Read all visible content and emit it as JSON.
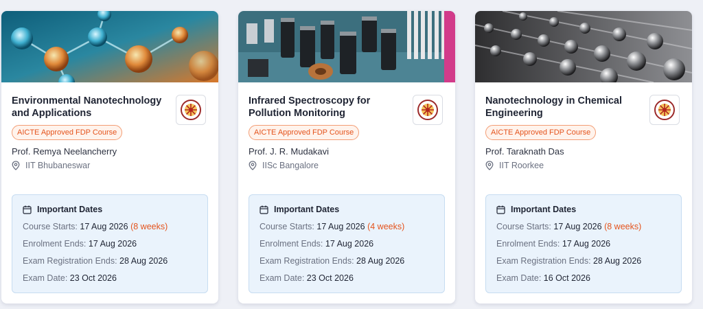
{
  "courses": [
    {
      "title": "Environmental Nanotechnology and Applications",
      "badge": "AICTE Approved FDP Course",
      "professor": "Prof. Remya Neelancherry",
      "institute": "IIT Bhubaneswar",
      "dates_heading": "Important Dates",
      "course_starts_label": "Course Starts:",
      "course_starts": "17 Aug 2026",
      "duration": "(8 weeks)",
      "enrolment_ends_label": "Enrolment Ends:",
      "enrolment_ends": "17 Aug 2026",
      "exam_registration_ends_label": "Exam Registration Ends:",
      "exam_registration_ends": "28 Aug 2026",
      "exam_date_label": "Exam Date:",
      "exam_date": "23 Oct 2026"
    },
    {
      "title": "Infrared Spectroscopy for Pollution Monitoring",
      "badge": "AICTE Approved FDP Course",
      "professor": "Prof. J. R. Mudakavi",
      "institute": "IISc Bangalore",
      "dates_heading": "Important Dates",
      "course_starts_label": "Course Starts:",
      "course_starts": "17 Aug 2026",
      "duration": "(4 weeks)",
      "enrolment_ends_label": "Enrolment Ends:",
      "enrolment_ends": "17 Aug 2026",
      "exam_registration_ends_label": "Exam Registration Ends:",
      "exam_registration_ends": "28 Aug 2026",
      "exam_date_label": "Exam Date:",
      "exam_date": "23 Oct 2026"
    },
    {
      "title": "Nanotechnology in Chemical Engineering",
      "badge": "AICTE Approved FDP Course",
      "professor": "Prof. Taraknath Das",
      "institute": "IIT Roorkee",
      "dates_heading": "Important Dates",
      "course_starts_label": "Course Starts:",
      "course_starts": "17 Aug 2026",
      "duration": "(8 weeks)",
      "enrolment_ends_label": "Enrolment Ends:",
      "enrolment_ends": "17 Aug 2026",
      "exam_registration_ends_label": "Exam Registration Ends:",
      "exam_registration_ends": "28 Aug 2026",
      "exam_date_label": "Exam Date:",
      "exam_date": "16 Oct 2026"
    }
  ],
  "icons": {
    "location": "map-pin-icon",
    "calendar": "calendar-icon",
    "logo": "nptel-logo-icon"
  },
  "colors": {
    "accent": "#e4531c",
    "dates_bg": "#eaf3fc",
    "title": "#1f2433"
  }
}
